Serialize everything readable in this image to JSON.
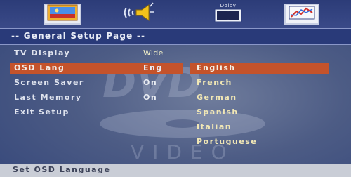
{
  "tabs": [
    {
      "name": "general-setup",
      "icon": "picture-icon"
    },
    {
      "name": "audio-setup",
      "icon": "speaker-icon"
    },
    {
      "name": "dolby-setup",
      "icon": "dolby-icon",
      "label": "Dolby"
    },
    {
      "name": "preference-setup",
      "icon": "chart-icon"
    }
  ],
  "title": "-- General Setup Page --",
  "menu": {
    "items": [
      {
        "label": "TV Display",
        "value": "Wide"
      },
      {
        "label": "OSD Lang",
        "value": "Eng",
        "selected": true
      },
      {
        "label": "Screen Saver",
        "value": "On"
      },
      {
        "label": "Last Memory",
        "value": "On"
      },
      {
        "label": "Exit Setup",
        "value": ""
      }
    ]
  },
  "options": {
    "items": [
      {
        "label": "English",
        "selected": true
      },
      {
        "label": "French"
      },
      {
        "label": "German"
      },
      {
        "label": "Spanish"
      },
      {
        "label": "Italian"
      },
      {
        "label": "Portuguese"
      }
    ]
  },
  "watermark": {
    "text": "VIDEO"
  },
  "status": {
    "text": "Set OSD Language"
  },
  "colors": {
    "highlight": "#c4532b",
    "background": "#4d5c85",
    "title_bar": "#293a79",
    "status_bar": "#c9cdd6",
    "option_text": "#f1e7b5"
  }
}
